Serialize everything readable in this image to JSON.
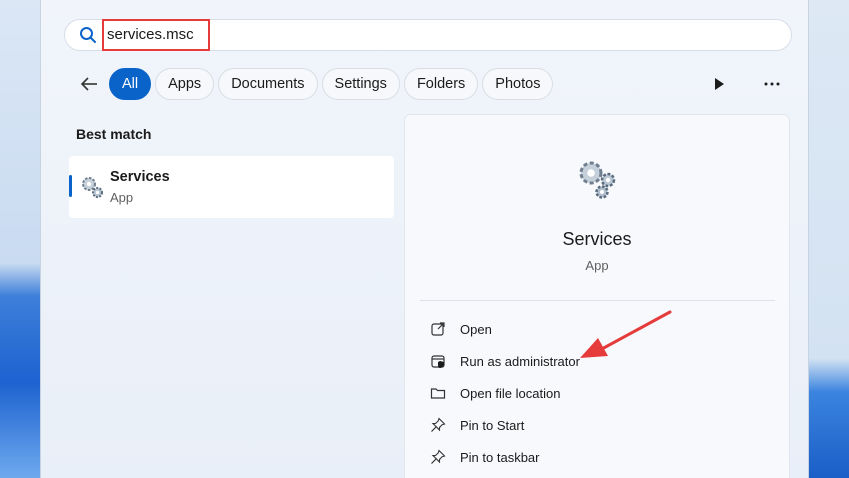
{
  "search": {
    "value": "services.msc"
  },
  "filters": [
    "All",
    "Apps",
    "Documents",
    "Settings",
    "Folders",
    "Photos"
  ],
  "best_match": {
    "heading": "Best match",
    "title": "Services",
    "type": "App"
  },
  "detail": {
    "title": "Services",
    "type": "App",
    "actions": [
      "Open",
      "Run as administrator",
      "Open file location",
      "Pin to Start",
      "Pin to taskbar"
    ]
  },
  "colors": {
    "accent": "#0a63c9",
    "annotation": "#e53b3b"
  }
}
